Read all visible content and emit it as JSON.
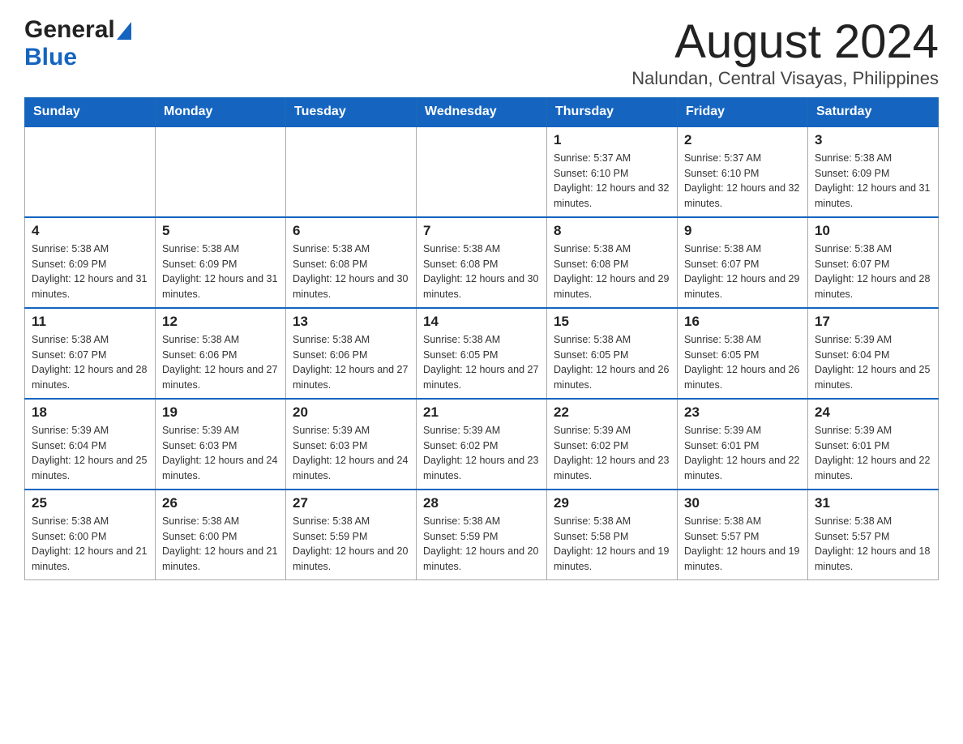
{
  "header": {
    "logo_general": "General",
    "logo_blue": "Blue",
    "month_title": "August 2024",
    "location": "Nalundan, Central Visayas, Philippines"
  },
  "days_of_week": [
    "Sunday",
    "Monday",
    "Tuesday",
    "Wednesday",
    "Thursday",
    "Friday",
    "Saturday"
  ],
  "weeks": [
    {
      "days": [
        {
          "num": "",
          "info": ""
        },
        {
          "num": "",
          "info": ""
        },
        {
          "num": "",
          "info": ""
        },
        {
          "num": "",
          "info": ""
        },
        {
          "num": "1",
          "info": "Sunrise: 5:37 AM\nSunset: 6:10 PM\nDaylight: 12 hours and 32 minutes."
        },
        {
          "num": "2",
          "info": "Sunrise: 5:37 AM\nSunset: 6:10 PM\nDaylight: 12 hours and 32 minutes."
        },
        {
          "num": "3",
          "info": "Sunrise: 5:38 AM\nSunset: 6:09 PM\nDaylight: 12 hours and 31 minutes."
        }
      ]
    },
    {
      "days": [
        {
          "num": "4",
          "info": "Sunrise: 5:38 AM\nSunset: 6:09 PM\nDaylight: 12 hours and 31 minutes."
        },
        {
          "num": "5",
          "info": "Sunrise: 5:38 AM\nSunset: 6:09 PM\nDaylight: 12 hours and 31 minutes."
        },
        {
          "num": "6",
          "info": "Sunrise: 5:38 AM\nSunset: 6:08 PM\nDaylight: 12 hours and 30 minutes."
        },
        {
          "num": "7",
          "info": "Sunrise: 5:38 AM\nSunset: 6:08 PM\nDaylight: 12 hours and 30 minutes."
        },
        {
          "num": "8",
          "info": "Sunrise: 5:38 AM\nSunset: 6:08 PM\nDaylight: 12 hours and 29 minutes."
        },
        {
          "num": "9",
          "info": "Sunrise: 5:38 AM\nSunset: 6:07 PM\nDaylight: 12 hours and 29 minutes."
        },
        {
          "num": "10",
          "info": "Sunrise: 5:38 AM\nSunset: 6:07 PM\nDaylight: 12 hours and 28 minutes."
        }
      ]
    },
    {
      "days": [
        {
          "num": "11",
          "info": "Sunrise: 5:38 AM\nSunset: 6:07 PM\nDaylight: 12 hours and 28 minutes."
        },
        {
          "num": "12",
          "info": "Sunrise: 5:38 AM\nSunset: 6:06 PM\nDaylight: 12 hours and 27 minutes."
        },
        {
          "num": "13",
          "info": "Sunrise: 5:38 AM\nSunset: 6:06 PM\nDaylight: 12 hours and 27 minutes."
        },
        {
          "num": "14",
          "info": "Sunrise: 5:38 AM\nSunset: 6:05 PM\nDaylight: 12 hours and 27 minutes."
        },
        {
          "num": "15",
          "info": "Sunrise: 5:38 AM\nSunset: 6:05 PM\nDaylight: 12 hours and 26 minutes."
        },
        {
          "num": "16",
          "info": "Sunrise: 5:38 AM\nSunset: 6:05 PM\nDaylight: 12 hours and 26 minutes."
        },
        {
          "num": "17",
          "info": "Sunrise: 5:39 AM\nSunset: 6:04 PM\nDaylight: 12 hours and 25 minutes."
        }
      ]
    },
    {
      "days": [
        {
          "num": "18",
          "info": "Sunrise: 5:39 AM\nSunset: 6:04 PM\nDaylight: 12 hours and 25 minutes."
        },
        {
          "num": "19",
          "info": "Sunrise: 5:39 AM\nSunset: 6:03 PM\nDaylight: 12 hours and 24 minutes."
        },
        {
          "num": "20",
          "info": "Sunrise: 5:39 AM\nSunset: 6:03 PM\nDaylight: 12 hours and 24 minutes."
        },
        {
          "num": "21",
          "info": "Sunrise: 5:39 AM\nSunset: 6:02 PM\nDaylight: 12 hours and 23 minutes."
        },
        {
          "num": "22",
          "info": "Sunrise: 5:39 AM\nSunset: 6:02 PM\nDaylight: 12 hours and 23 minutes."
        },
        {
          "num": "23",
          "info": "Sunrise: 5:39 AM\nSunset: 6:01 PM\nDaylight: 12 hours and 22 minutes."
        },
        {
          "num": "24",
          "info": "Sunrise: 5:39 AM\nSunset: 6:01 PM\nDaylight: 12 hours and 22 minutes."
        }
      ]
    },
    {
      "days": [
        {
          "num": "25",
          "info": "Sunrise: 5:38 AM\nSunset: 6:00 PM\nDaylight: 12 hours and 21 minutes."
        },
        {
          "num": "26",
          "info": "Sunrise: 5:38 AM\nSunset: 6:00 PM\nDaylight: 12 hours and 21 minutes."
        },
        {
          "num": "27",
          "info": "Sunrise: 5:38 AM\nSunset: 5:59 PM\nDaylight: 12 hours and 20 minutes."
        },
        {
          "num": "28",
          "info": "Sunrise: 5:38 AM\nSunset: 5:59 PM\nDaylight: 12 hours and 20 minutes."
        },
        {
          "num": "29",
          "info": "Sunrise: 5:38 AM\nSunset: 5:58 PM\nDaylight: 12 hours and 19 minutes."
        },
        {
          "num": "30",
          "info": "Sunrise: 5:38 AM\nSunset: 5:57 PM\nDaylight: 12 hours and 19 minutes."
        },
        {
          "num": "31",
          "info": "Sunrise: 5:38 AM\nSunset: 5:57 PM\nDaylight: 12 hours and 18 minutes."
        }
      ]
    }
  ]
}
